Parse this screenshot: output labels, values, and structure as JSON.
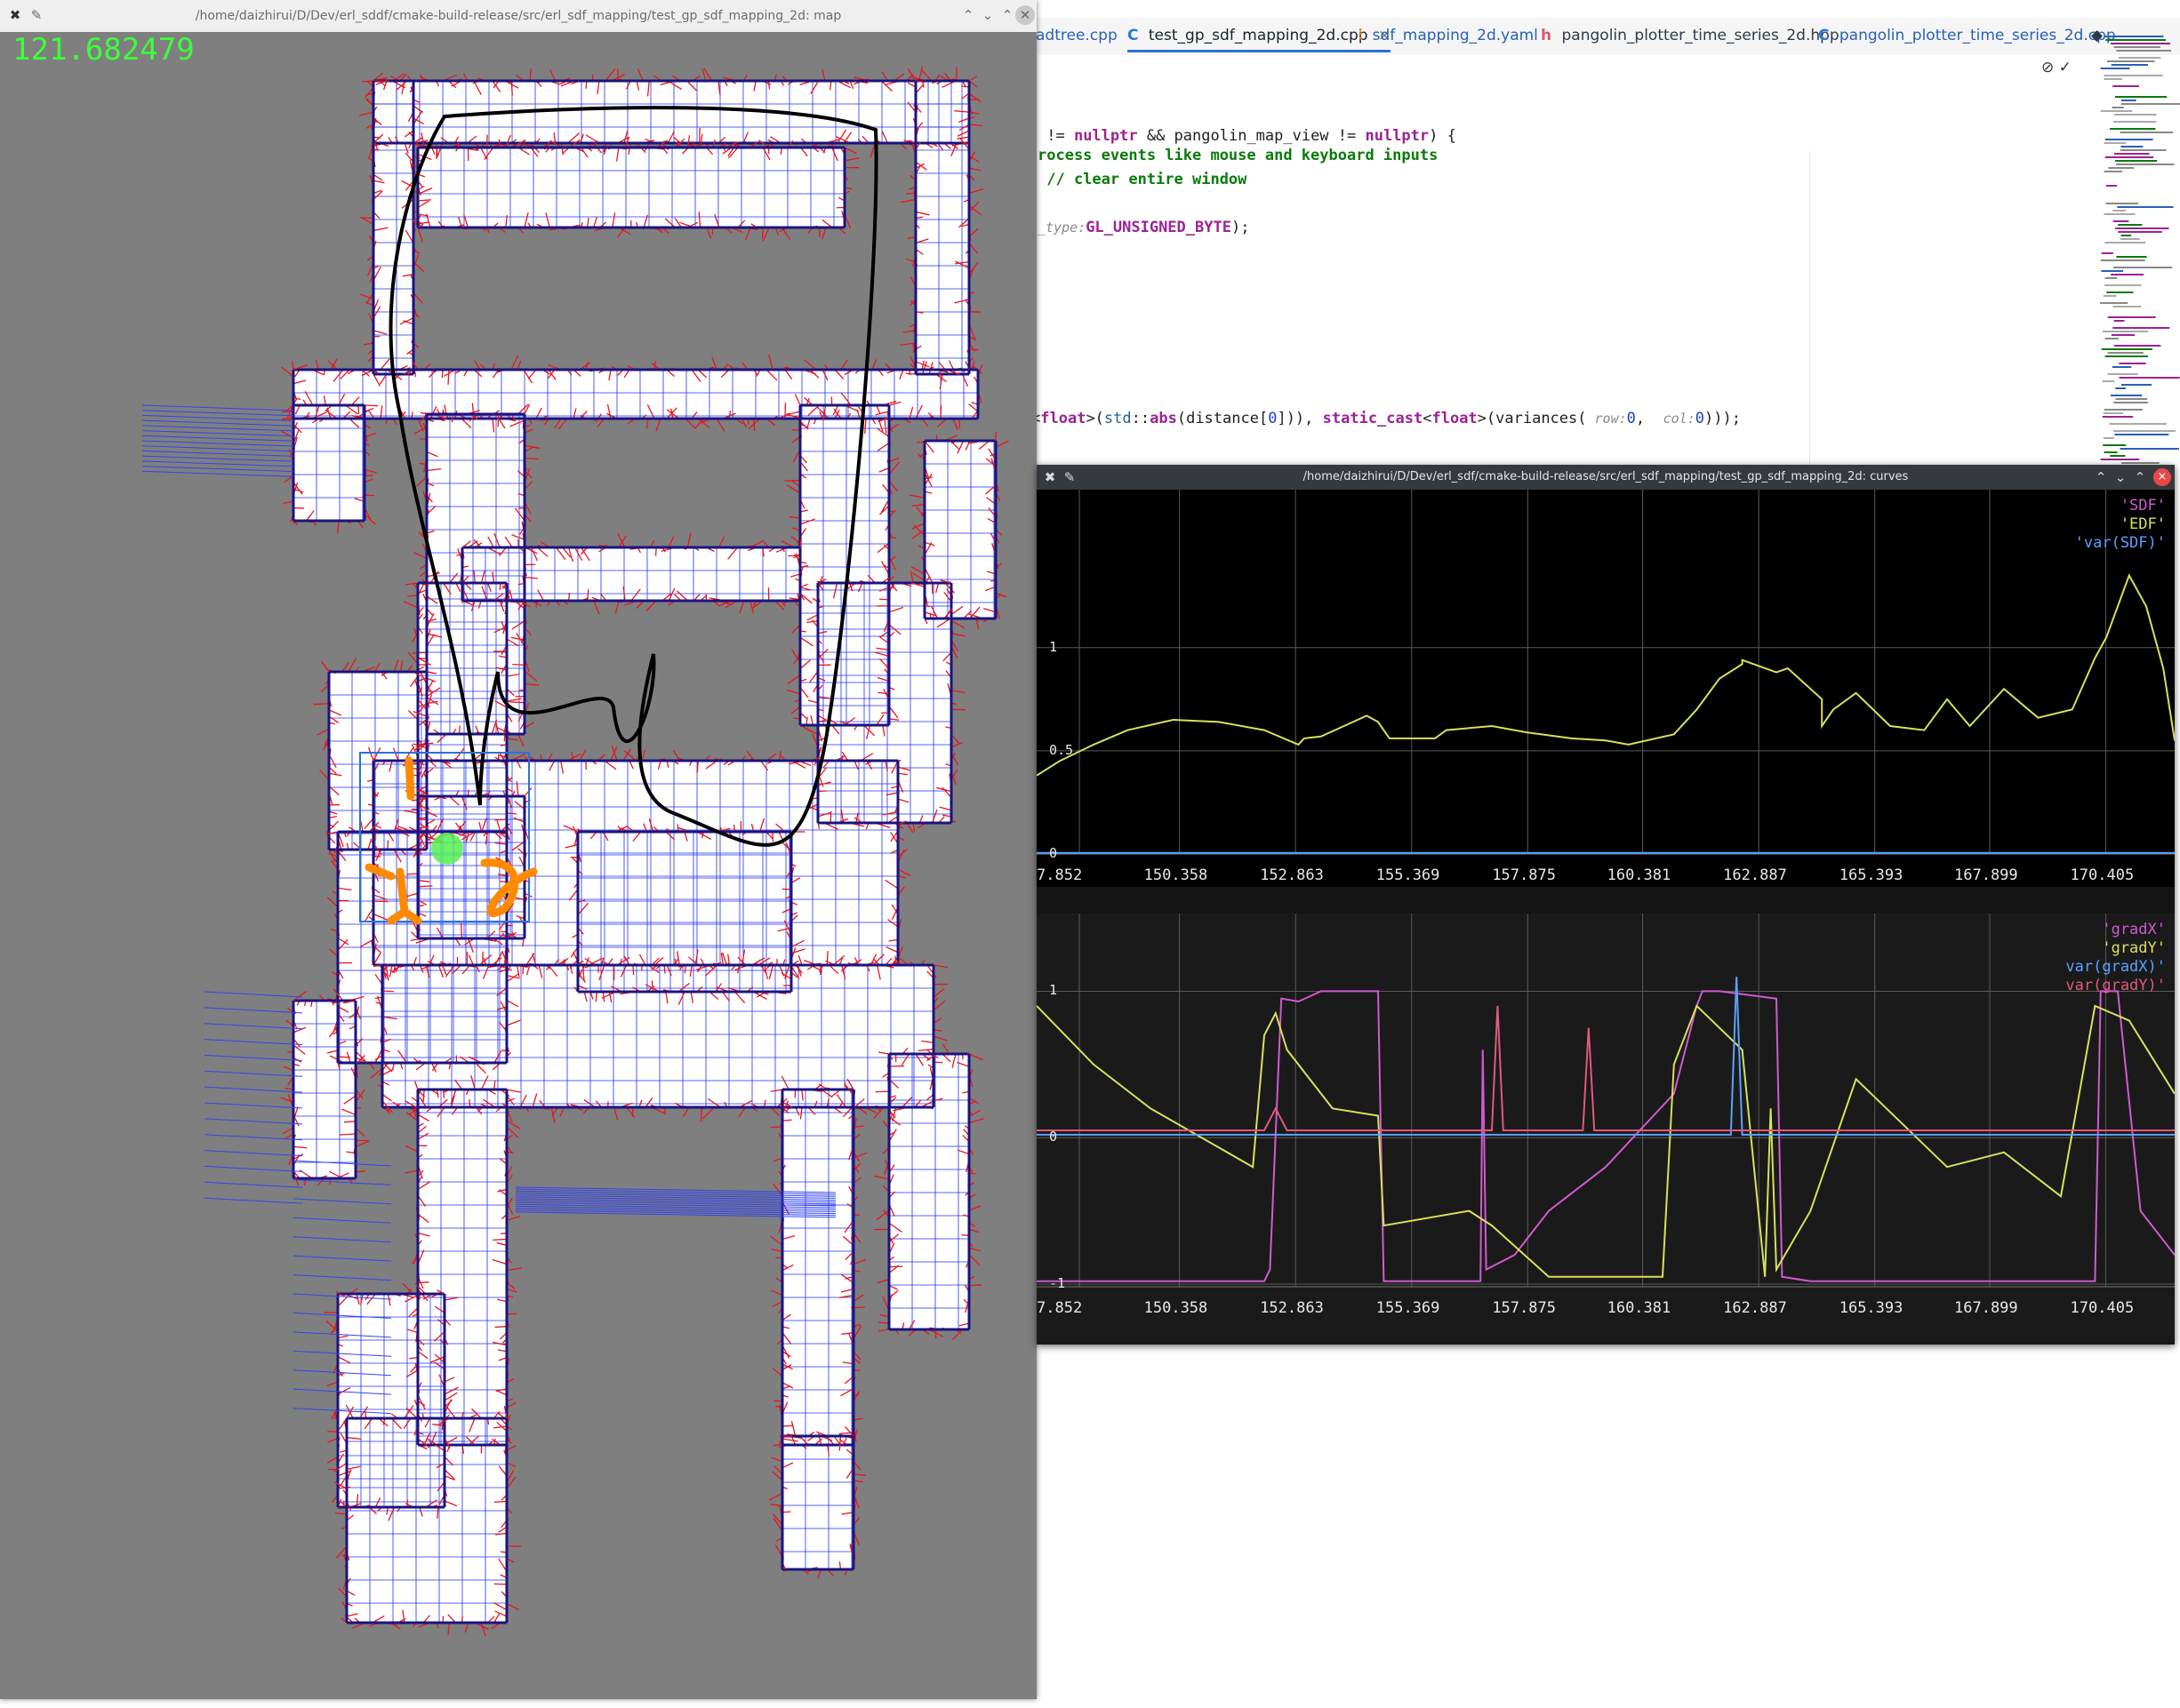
{
  "ide": {
    "tabs": [
      {
        "icon": "",
        "label": "adtree.cpp",
        "color": "#2a5fb8"
      },
      {
        "icon": "C",
        "label": "test_gp_sdf_mapping_2d.cpp",
        "color": "#1a2230",
        "close": "×"
      },
      {
        "icon": "⫶",
        "label": "sdf_mapping_2d.yaml",
        "color": "#2a5fb8"
      },
      {
        "icon": "h",
        "label": "pangolin_plotter_time_series_2d.hpp",
        "color": "#1a2230"
      },
      {
        "icon": "C",
        "label": "pangolin_plotter_time_series_2d.cpp",
        "color": "#2a5fb8"
      }
    ],
    "tab_menu_icon": "◆",
    "code": {
      "l1_a": " != ",
      "l1_b": "nullptr",
      "l1_c": " && pangolin_map_view != ",
      "l1_d": "nullptr",
      "l1_e": ") {",
      "l2": "rocess events like mouse and keyboard inputs",
      "l3": " // clear entire window",
      "l4_hint": "_type:",
      "l4_val": "GL_UNSIGNED_BYTE",
      "l4_end": ");",
      "l5_a": "<",
      "l5_b": "float",
      "l5_c": ">(",
      "l5_d": "std",
      "l5_e": "::",
      "l5_f": "abs",
      "l5_g": "(distance[",
      "l5_h": "0",
      "l5_i": "])), ",
      "l5_j": "static_cast",
      "l5_k": "<",
      "l5_l": "float",
      "l5_m": ">(variances(",
      "l5_n": " row:",
      "l5_o": "0",
      "l5_p": ",  ",
      "l5_q": "col:",
      "l5_r": "0",
      "l5_s": ")));"
    },
    "editor_icons": "⊘  ✓"
  },
  "map_window": {
    "title": "/home/daizhirui/D/Dev/erl_sddf/cmake-build-release/src/erl_sdf_mapping/test_gp_sdf_mapping_2d: map",
    "timer": "121.682479",
    "buttons": [
      "⌃",
      "⌄",
      "⌃",
      "✕"
    ]
  },
  "curves_window": {
    "title": "/home/daizhirui/D/Dev/erl_sdf/cmake-build-release/src/erl_sdf_mapping/test_gp_sdf_mapping_2d: curves",
    "buttons": [
      "⌃",
      "⌄",
      "⌃",
      "×"
    ]
  },
  "chart_data": [
    {
      "type": "line",
      "x_ticks": [
        "7.852",
        "150.358",
        "152.863",
        "155.369",
        "157.875",
        "160.381",
        "162.887",
        "165.393",
        "167.899",
        "170.405"
      ],
      "y_ticks": [
        "1",
        "0.5",
        "0"
      ],
      "ylim": [
        0,
        1.55
      ],
      "legend": [
        "'SDF'",
        "'EDF'",
        "'var(SDF)'"
      ],
      "colors": {
        "SDF": "#d05ad0",
        "EDF": "#d8e05a",
        "var(SDF)": "#5aa0ff"
      },
      "series": [
        {
          "name": "'EDF'",
          "x": [
            0,
            0.02,
            0.05,
            0.08,
            0.12,
            0.16,
            0.2,
            0.23,
            0.235,
            0.25,
            0.29,
            0.3,
            0.31,
            0.35,
            0.36,
            0.4,
            0.43,
            0.47,
            0.5,
            0.52,
            0.56,
            0.58,
            0.6,
            0.62,
            0.62,
            0.65,
            0.66,
            0.69,
            0.69,
            0.7,
            0.72,
            0.75,
            0.78,
            0.8,
            0.82,
            0.85,
            0.88,
            0.91,
            0.93,
            0.94,
            0.96,
            0.975,
            0.99,
            1.0
          ],
          "y": [
            0.38,
            0.45,
            0.53,
            0.6,
            0.65,
            0.64,
            0.6,
            0.53,
            0.56,
            0.57,
            0.67,
            0.64,
            0.56,
            0.56,
            0.6,
            0.62,
            0.59,
            0.56,
            0.55,
            0.53,
            0.58,
            0.7,
            0.85,
            0.92,
            0.94,
            0.88,
            0.9,
            0.75,
            0.62,
            0.7,
            0.78,
            0.62,
            0.6,
            0.75,
            0.62,
            0.8,
            0.66,
            0.7,
            0.95,
            1.05,
            1.35,
            1.2,
            0.9,
            0.55
          ]
        },
        {
          "name": "'var(SDF)'",
          "x": [
            0,
            1
          ],
          "y": [
            0.005,
            0.005
          ]
        }
      ]
    },
    {
      "type": "line",
      "x_ticks": [
        "7.852",
        "150.358",
        "152.863",
        "155.369",
        "157.875",
        "160.381",
        "162.887",
        "165.393",
        "167.899",
        "170.405"
      ],
      "y_ticks": [
        "1",
        "0",
        "-1"
      ],
      "ylim": [
        -1.2,
        1.3
      ],
      "legend": [
        "'gradX'",
        "'gradY'",
        "var(gradX)'",
        "var(gradY)'"
      ],
      "colors": {
        "gradX": "#d05ad0",
        "gradY": "#d8e05a",
        "var(gradX)": "#5aa0ff",
        "var(gradY)": "#e05a7a"
      },
      "series": [
        {
          "name": "'gradX'",
          "x": [
            0,
            0.2,
            0.205,
            0.215,
            0.23,
            0.25,
            0.3,
            0.305,
            0.39,
            0.392,
            0.395,
            0.42,
            0.45,
            0.5,
            0.56,
            0.58,
            0.585,
            0.6,
            0.65,
            0.655,
            0.68,
            0.7,
            0.8,
            0.9,
            0.93,
            0.935,
            0.95,
            0.97,
            1.0
          ],
          "y": [
            -0.98,
            -0.98,
            -0.9,
            0.95,
            0.93,
            1.0,
            1.0,
            -0.98,
            -0.98,
            0.6,
            -0.9,
            -0.8,
            -0.5,
            -0.2,
            0.3,
            0.9,
            1.0,
            1.0,
            0.95,
            -0.95,
            -0.98,
            -0.98,
            -0.98,
            -0.98,
            -0.98,
            1.0,
            1.0,
            -0.5,
            -0.8
          ]
        },
        {
          "name": "'gradY'",
          "x": [
            0,
            0.05,
            0.1,
            0.19,
            0.2,
            0.21,
            0.22,
            0.26,
            0.3,
            0.305,
            0.38,
            0.4,
            0.45,
            0.5,
            0.55,
            0.56,
            0.58,
            0.62,
            0.64,
            0.645,
            0.65,
            0.68,
            0.72,
            0.8,
            0.85,
            0.9,
            0.93,
            0.96,
            1.0
          ],
          "y": [
            0.9,
            0.5,
            0.2,
            -0.2,
            0.7,
            0.85,
            0.6,
            0.2,
            0.15,
            -0.6,
            -0.5,
            -0.6,
            -0.95,
            -0.95,
            -0.95,
            0.5,
            0.9,
            0.6,
            -0.95,
            0.2,
            -0.9,
            -0.5,
            0.4,
            -0.2,
            -0.1,
            -0.4,
            0.9,
            0.8,
            0.3
          ]
        },
        {
          "name": "var(gradX)'",
          "x": [
            0,
            0.61,
            0.615,
            0.62,
            1
          ],
          "y": [
            0.02,
            0.02,
            1.1,
            0.02,
            0.02
          ]
        },
        {
          "name": "var(gradY)'",
          "x": [
            0,
            0.2,
            0.21,
            0.22,
            0.4,
            0.405,
            0.41,
            0.48,
            0.485,
            0.49,
            1
          ],
          "y": [
            0.05,
            0.05,
            0.2,
            0.05,
            0.05,
            0.9,
            0.05,
            0.05,
            0.75,
            0.05,
            0.05
          ]
        }
      ]
    }
  ]
}
